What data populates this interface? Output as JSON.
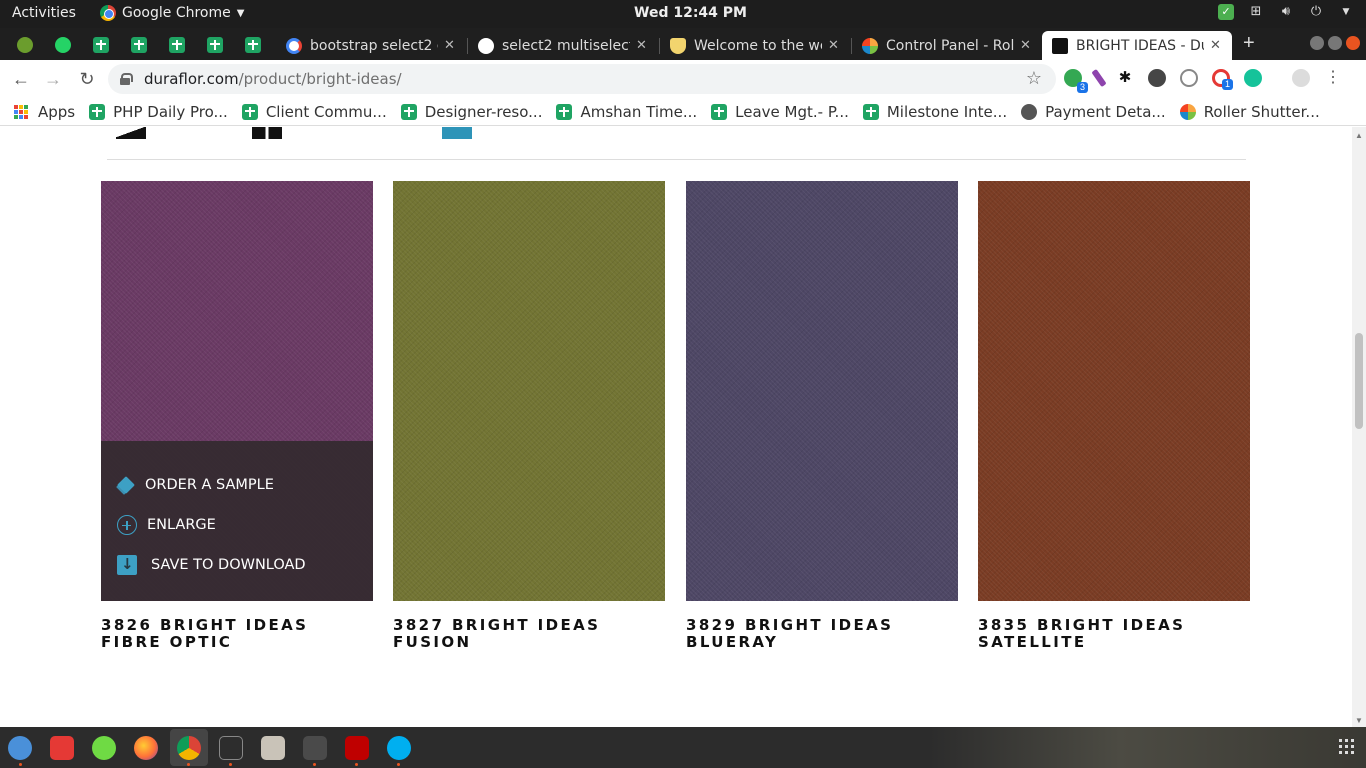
{
  "topbar": {
    "activities": "Activities",
    "app_name": "Google Chrome",
    "clock": "Wed 12:44 PM"
  },
  "tabs": [
    {
      "title": "bootstrap select2 c",
      "icon": "google-icon"
    },
    {
      "title": "select2 multiselect",
      "icon": "codepen-icon"
    },
    {
      "title": "Welcome to the we",
      "icon": "shield-icon"
    },
    {
      "title": "Control Panel - Rol",
      "icon": "joomla-icon"
    },
    {
      "title": "BRIGHT IDEAS - Du",
      "icon": "duraflor-icon",
      "active": true
    }
  ],
  "address": {
    "host": "duraflor.com",
    "path": "/product/bright-ideas/"
  },
  "extensions": {
    "badge_1": "3",
    "badge_2": "1"
  },
  "bookmarks": [
    {
      "label": "Apps",
      "icon": "apps-icon"
    },
    {
      "label": "PHP Daily Pro...",
      "icon": "sheets-icon"
    },
    {
      "label": "Client Commu...",
      "icon": "sheets-icon"
    },
    {
      "label": "Designer-reso...",
      "icon": "sheets-icon"
    },
    {
      "label": "Amshan Time...",
      "icon": "sheets-icon"
    },
    {
      "label": "Leave Mgt.- P...",
      "icon": "sheets-icon"
    },
    {
      "label": "Milestone Inte...",
      "icon": "sheets-icon"
    },
    {
      "label": "Payment Deta...",
      "icon": "globe-icon"
    },
    {
      "label": "Roller Shutter...",
      "icon": "joomla-icon"
    }
  ],
  "products": [
    {
      "title": "3826 BRIGHT IDEAS FIBRE OPTIC",
      "color": "#6a3a64"
    },
    {
      "title": "3827 BRIGHT IDEAS FUSION",
      "color": "#727433"
    },
    {
      "title": "3829 BRIGHT IDEAS BLUERAY",
      "color": "#4e4765"
    },
    {
      "title": "3835 BRIGHT IDEAS SATELLITE",
      "color": "#7a3c24"
    }
  ],
  "overlay": {
    "order_sample": "ORDER A SAMPLE",
    "enlarge": "ENLARGE",
    "save_download": "SAVE TO DOWNLOAD"
  },
  "colors": {
    "accent": "#3da0c4",
    "overlay": "#342a30"
  }
}
